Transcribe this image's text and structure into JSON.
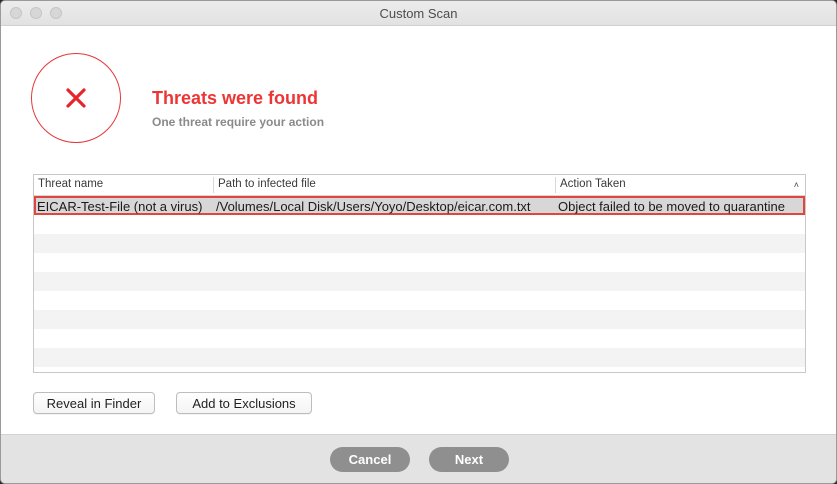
{
  "window": {
    "title": "Custom Scan"
  },
  "alert": {
    "icon": "x-icon",
    "accent_color": "#ee3535",
    "headline": "Threats were found",
    "subline": "One threat require your action"
  },
  "table": {
    "columns": [
      "Threat name",
      "Path to infected file",
      "Action Taken"
    ],
    "rows": [
      {
        "threat_name": "EICAR-Test-File (not a virus)",
        "path": "/Volumes/Local Disk/Users/Yoyo/Desktop/eicar.com.txt",
        "action": "Object failed to be moved to quarantine"
      }
    ]
  },
  "buttons": {
    "reveal": "Reveal in Finder",
    "exclusions": "Add to Exclusions",
    "cancel": "Cancel",
    "next": "Next"
  }
}
